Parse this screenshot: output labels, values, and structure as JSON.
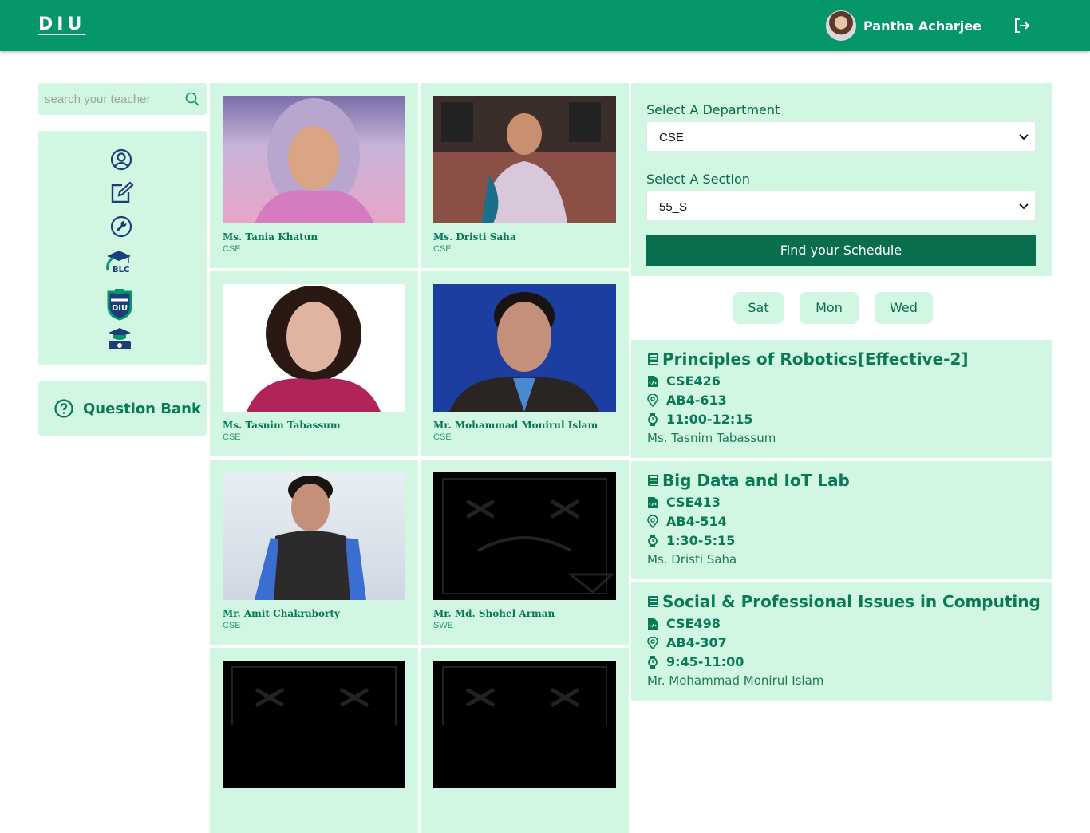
{
  "header": {
    "brand": "DIU",
    "user_name": "Pantha Acharjee"
  },
  "search": {
    "placeholder": "search your teacher"
  },
  "sidebar": {
    "menu_icons": [
      "user-circle-icon",
      "edit-icon",
      "wrench-icon",
      "blc-logo-icon",
      "diu-logo-icon",
      "graduation-icon"
    ],
    "question_bank_label": "Question Bank"
  },
  "teachers": [
    {
      "name": "Ms. Tania Khatun",
      "dept": "CSE"
    },
    {
      "name": "Ms. Dristi Saha",
      "dept": "CSE"
    },
    {
      "name": "Ms. Tasnim Tabassum",
      "dept": "CSE"
    },
    {
      "name": "Mr. Mohammad Monirul Islam",
      "dept": "CSE"
    },
    {
      "name": "Mr. Amit Chakraborty",
      "dept": "CSE"
    },
    {
      "name": "Mr. Md. Shohel Arman",
      "dept": "SWE"
    }
  ],
  "schedule_form": {
    "department_label": "Select A Department",
    "department_value": "CSE",
    "section_label": "Select A Section",
    "section_value": "55_S",
    "button_label": "Find your Schedule"
  },
  "days": [
    "Sat",
    "Mon",
    "Wed"
  ],
  "courses": [
    {
      "title": "Principles of Robotics[Effective-2]",
      "code": "CSE426",
      "room": "AB4-613",
      "time": "11:00-12:15",
      "teacher": "Ms. Tasnim Tabassum"
    },
    {
      "title": "Big Data and IoT Lab",
      "code": "CSE413",
      "room": "AB4-514",
      "time": "1:30-5:15",
      "teacher": "Ms. Dristi Saha"
    },
    {
      "title": "Social & Professional Issues in Computing",
      "code": "CSE498",
      "room": "AB4-307",
      "time": "9:45-11:00",
      "teacher": "Mr. Mohammad Monirul Islam"
    }
  ],
  "colors": {
    "header": "#05966a",
    "panel": "#d1f7e3",
    "accent_text": "#087a56",
    "button": "#0a6e4e"
  }
}
